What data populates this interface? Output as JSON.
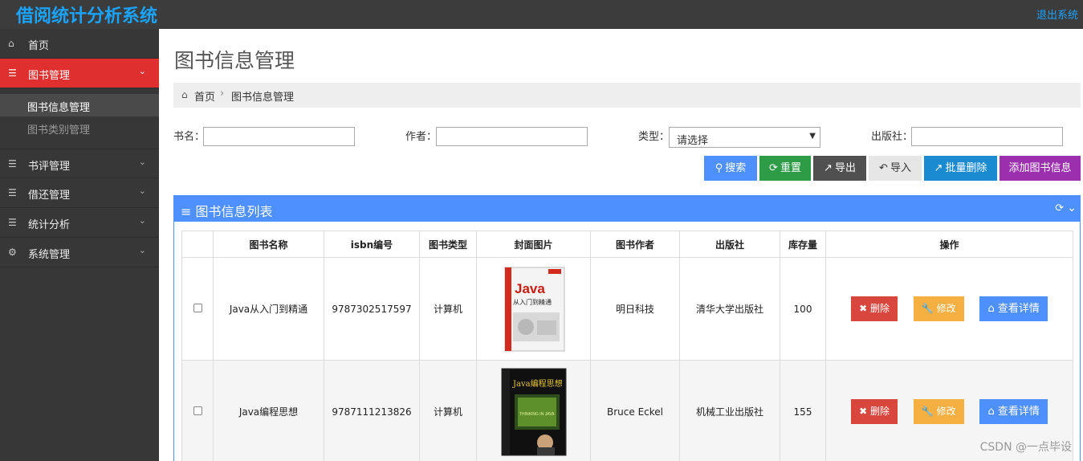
{
  "header": {
    "app_title": "借阅统计分析系统",
    "logout_label": "退出系统"
  },
  "sidebar": {
    "items": [
      {
        "label": "首页",
        "icon": "home-icon"
      },
      {
        "label": "图书管理",
        "icon": "list-icon",
        "expanded": true
      },
      {
        "label": "书评管理",
        "icon": "list-icon"
      },
      {
        "label": "借还管理",
        "icon": "list-icon"
      },
      {
        "label": "统计分析",
        "icon": "list-icon"
      },
      {
        "label": "系统管理",
        "icon": "gears-icon"
      }
    ],
    "subitems": [
      {
        "label": "图书信息管理"
      },
      {
        "label": "图书类别管理"
      }
    ]
  },
  "page": {
    "title": "图书信息管理",
    "breadcrumb": [
      "首页",
      "图书信息管理"
    ]
  },
  "filters": {
    "name_label": "书名：",
    "author_label": "作者：",
    "type_label": "类型：",
    "type_value": "请选择",
    "publisher_label": "出版社："
  },
  "toolbar": {
    "search": "搜索",
    "reset": "重置",
    "export": "导出",
    "import": "导入",
    "batch_delete": "批量删除",
    "add": "添加图书信息"
  },
  "panel": {
    "title": "图书信息列表"
  },
  "table": {
    "headers": [
      "图书名称",
      "isbn编号",
      "图书类型",
      "封面图片",
      "图书作者",
      "出版社",
      "库存量",
      "操作"
    ],
    "rows": [
      {
        "name": "Java从入门到精通",
        "isbn": "9787302517597",
        "type": "计算机",
        "author": "明日科技",
        "publisher": "清华大学出版社",
        "stock": "100",
        "cover_text": "Java",
        "cover_sub": "从入门到精通"
      },
      {
        "name": "Java编程思想",
        "isbn": "9787111213826",
        "type": "计算机",
        "author": "Bruce Eckel",
        "publisher": "机械工业出版社",
        "stock": "155",
        "cover_text": "Java编程思想",
        "cover_sub": "THINKING IN JAVA"
      }
    ],
    "actions": {
      "delete": "删除",
      "edit": "修改",
      "detail": "查看详情"
    }
  },
  "watermark": "CSDN @一点毕设",
  "colors": {
    "accent_red": "#e02f2f",
    "primary_blue": "#4d90fe",
    "brand_blue": "#1aa3ff"
  }
}
